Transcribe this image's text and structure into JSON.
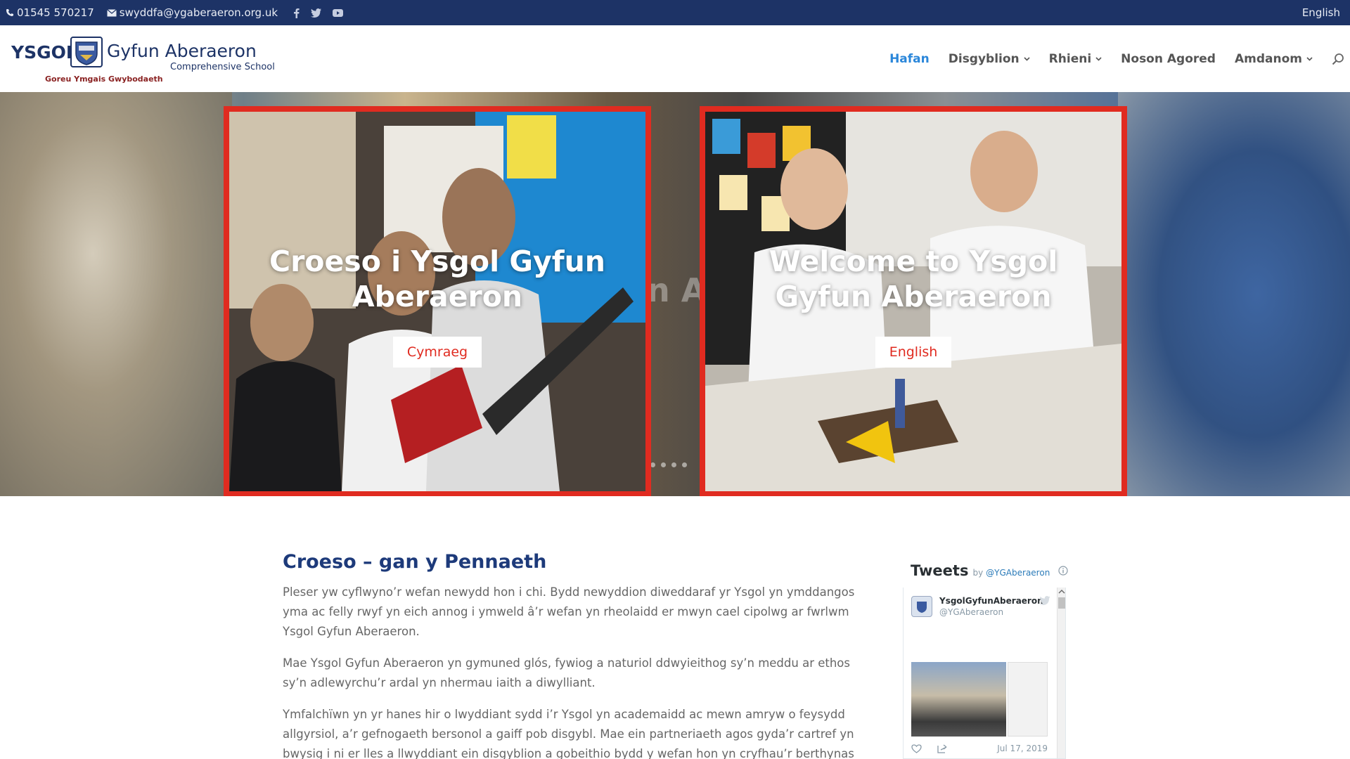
{
  "topbar": {
    "phone": "01545 570217",
    "email": "swyddfa@ygaberaeron.org.uk",
    "language_link": "English"
  },
  "logo": {
    "word_ysgol": "YSGOL",
    "word_gyfun": "Gyfun Aberaeron",
    "word_comprehensive": "Comprehensive School",
    "motto": "Goreu Ymgais Gwybodaeth"
  },
  "nav": {
    "items": [
      {
        "label": "Hafan",
        "active": true,
        "dropdown": false
      },
      {
        "label": "Disgyblion",
        "active": false,
        "dropdown": true
      },
      {
        "label": "Rhieni",
        "active": false,
        "dropdown": true
      },
      {
        "label": "Noson Agored",
        "active": false,
        "dropdown": false
      },
      {
        "label": "Amdanom",
        "active": false,
        "dropdown": true
      }
    ]
  },
  "hero": {
    "background_text": "n A",
    "left_panel": {
      "title": "Croeso i Ysgol Gyfun Aberaeron",
      "button": "Cymraeg"
    },
    "right_panel": {
      "title": "Welcome to Ysgol Gyfun Aberaeron",
      "button": "English"
    },
    "accent_color": "#e02b20"
  },
  "content": {
    "heading": "Croeso – gan y Pennaeth",
    "paragraphs": [
      "Pleser yw cyflwyno’r wefan newydd hon i chi. Bydd newyddion diweddaraf yr Ysgol yn ymddangos yma ac felly rwyf yn eich annog i ymweld â’r wefan yn rheolaidd er mwyn cael cipolwg ar fwrlwm Ysgol Gyfun Aberaeron.",
      "Mae Ysgol Gyfun Aberaeron yn gymuned glós, fywiog a naturiol ddwyieithog sy’n meddu ar ethos sy’n adlewyrchu’r ardal yn nhermau iaith a diwylliant.",
      "Ymfalchïwn yn yr hanes hir o lwyddiant sydd i’r Ysgol yn academaidd ac mewn amryw o feysydd allgyrsiol, a’r gefnogaeth bersonol a gaiff pob disgybl. Mae ein partneriaeth agos gyda’r cartref yn bwysig i ni er lles a llwyddiant ein disgyblion a gobeithio bydd y wefan hon yn cryfhau’r berthynas hanfodol honno."
    ]
  },
  "twitter": {
    "title": "Tweets",
    "by": "by",
    "handle": "@YGAberaeron",
    "tweet": {
      "name": "YsgolGyfunAberaeron",
      "handle": "@YGAberaeron",
      "date": "Jul 17, 2019"
    }
  },
  "colors": {
    "topbar_bg": "#1d3366",
    "nav_active": "#2b87da",
    "heading": "#1d3a7a"
  }
}
